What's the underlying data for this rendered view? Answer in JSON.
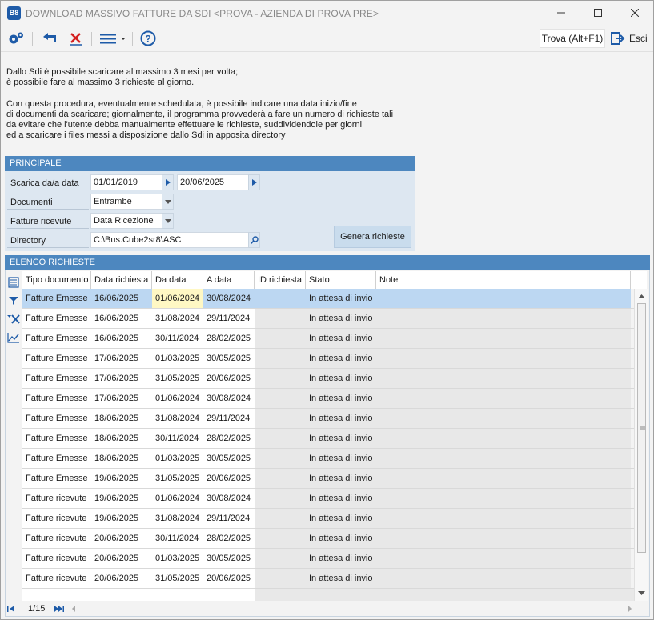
{
  "window": {
    "app_icon": "B8",
    "title": "DOWNLOAD MASSIVO FATTURE DA SDI <PROVA - AZIENDA DI PROVA PRE>",
    "minimize_icon": "minimize-icon",
    "maximize_icon": "maximize-icon",
    "close_icon": "close-icon"
  },
  "toolbar": {
    "icons": [
      "gears-icon",
      "undo-icon",
      "cancel-icon",
      "menu-icon",
      "help-icon"
    ],
    "find_label": "Trova (Alt+F1)",
    "exit_label": "Esci"
  },
  "info": {
    "line1": "Dallo Sdi è possibile scaricare al massimo 3 mesi per volta;",
    "line2": "è possibile fare al massimo 3 richieste al giorno.",
    "line3": "Con questa procedura, eventualmente schedulata, è possibile indicare una data inizio/fine",
    "line4": "di documenti da scaricare; giornalmente, il programma provvederà a fare un numero di richieste tali",
    "line5": "da evitare che l'utente debba manualmente effettuare le richieste, suddividendole per giorni",
    "line6": "ed a scaricare i files messi a disposizione dallo Sdi in apposita directory"
  },
  "principale": {
    "header": "PRINCIPALE",
    "range_label": "Scarica da/a data",
    "date_from": "01/01/2019",
    "date_to": "20/06/2025",
    "documents_label": "Documenti",
    "documents_value": "Entrambe",
    "received_label": "Fatture ricevute",
    "received_value": "Data Ricezione",
    "directory_label": "Directory",
    "directory_value": "C:\\Bus.Cube2sr8\\ASC",
    "generate_label": "Genera richieste"
  },
  "elenco": {
    "header": "ELENCO RICHIESTE",
    "columns": [
      "Tipo documento",
      "Data richiesta",
      "Da data",
      "A data",
      "ID richiesta",
      "Stato",
      "Note"
    ],
    "rows": [
      [
        "Fatture Emesse",
        "16/06/2025",
        "01/06/2024",
        "30/08/2024",
        "",
        "In attesa di invio",
        ""
      ],
      [
        "Fatture Emesse",
        "16/06/2025",
        "31/08/2024",
        "29/11/2024",
        "",
        "In attesa di invio",
        ""
      ],
      [
        "Fatture Emesse",
        "16/06/2025",
        "30/11/2024",
        "28/02/2025",
        "",
        "In attesa di invio",
        ""
      ],
      [
        "Fatture Emesse",
        "17/06/2025",
        "01/03/2025",
        "30/05/2025",
        "",
        "In attesa di invio",
        ""
      ],
      [
        "Fatture Emesse",
        "17/06/2025",
        "31/05/2025",
        "20/06/2025",
        "",
        "In attesa di invio",
        ""
      ],
      [
        "Fatture Emesse",
        "17/06/2025",
        "01/06/2024",
        "30/08/2024",
        "",
        "In attesa di invio",
        ""
      ],
      [
        "Fatture Emesse",
        "18/06/2025",
        "31/08/2024",
        "29/11/2024",
        "",
        "In attesa di invio",
        ""
      ],
      [
        "Fatture Emesse",
        "18/06/2025",
        "30/11/2024",
        "28/02/2025",
        "",
        "In attesa di invio",
        ""
      ],
      [
        "Fatture Emesse",
        "18/06/2025",
        "01/03/2025",
        "30/05/2025",
        "",
        "In attesa di invio",
        ""
      ],
      [
        "Fatture Emesse",
        "19/06/2025",
        "31/05/2025",
        "20/06/2025",
        "",
        "In attesa di invio",
        ""
      ],
      [
        "Fatture ricevute",
        "19/06/2025",
        "01/06/2024",
        "30/08/2024",
        "",
        "In attesa di invio",
        ""
      ],
      [
        "Fatture ricevute",
        "19/06/2025",
        "31/08/2024",
        "29/11/2024",
        "",
        "In attesa di invio",
        ""
      ],
      [
        "Fatture ricevute",
        "20/06/2025",
        "30/11/2024",
        "28/02/2025",
        "",
        "In attesa di invio",
        ""
      ],
      [
        "Fatture ricevute",
        "20/06/2025",
        "01/03/2025",
        "30/05/2025",
        "",
        "In attesa di invio",
        ""
      ],
      [
        "Fatture ricevute",
        "20/06/2025",
        "31/05/2025",
        "20/06/2025",
        "",
        "In attesa di invio",
        ""
      ]
    ],
    "selected_row": 0,
    "side_icons": [
      "list-icon",
      "filter-icon",
      "clear-filter-icon",
      "chart-icon"
    ],
    "pager": "1/15"
  },
  "colors": {
    "panel_header": "#4d87bf",
    "panel_body": "#dde7f1",
    "row_selected": "#bcd7f2",
    "cell_focus": "#fff8c4"
  }
}
